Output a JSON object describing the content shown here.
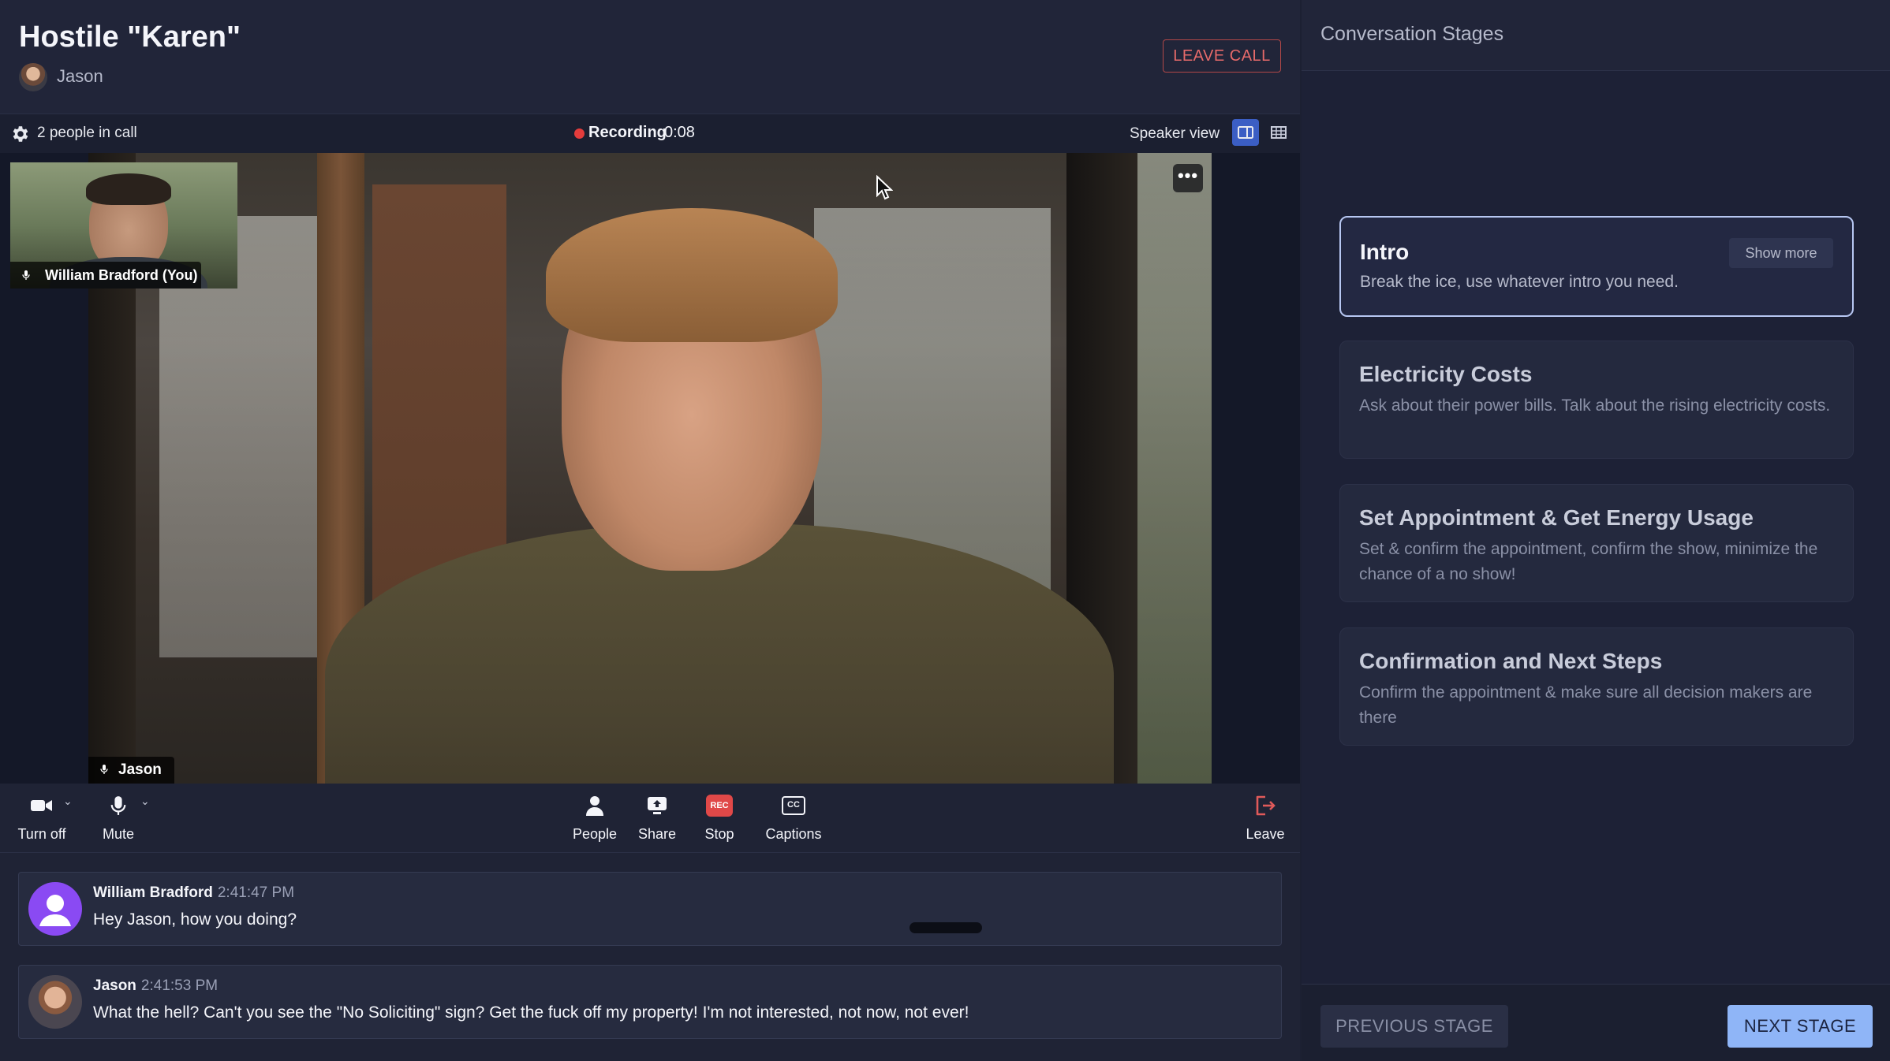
{
  "call": {
    "title": "Hostile \"Karen\"",
    "host_name": "Jason",
    "leave_call_label": "LEAVE CALL",
    "people_count": "2 people in call",
    "recording_label": "Recording",
    "recording_time": "0:08",
    "speaker_view_label": "Speaker view",
    "main_speaker": "Jason",
    "self_label": "William Bradford (You)",
    "more_label": "•••"
  },
  "toolbar": {
    "camera_label": "Turn off",
    "mute_label": "Mute",
    "people_label": "People",
    "share_label": "Share",
    "stop_label": "Stop",
    "rec_badge": "REC",
    "captions_label": "Captions",
    "captions_badge": "CC",
    "leave_label": "Leave"
  },
  "chat": [
    {
      "author": "William Bradford",
      "time": "2:41:47 PM",
      "text": "Hey Jason, how you doing?"
    },
    {
      "author": "Jason",
      "time": "2:41:53 PM",
      "text": "What the hell? Can't you see the \"No Soliciting\" sign? Get the fuck off my property! I'm not interested, not now, not ever!"
    }
  ],
  "stages_panel": {
    "title": "Conversation Stages",
    "show_more_label": "Show more",
    "stages": [
      {
        "title": "Intro",
        "description": "Break the ice, use whatever intro you need.",
        "active": true
      },
      {
        "title": "Electricity Costs",
        "description": "Ask about their power bills. Talk about the rising electricity costs.",
        "active": false
      },
      {
        "title": "Set Appointment & Get Energy Usage",
        "description": "Set & confirm the appointment, confirm the show, minimize the chance of a no show!",
        "active": false
      },
      {
        "title": "Confirmation and Next Steps",
        "description": "Confirm the appointment & make sure all decision makers are there",
        "active": false
      }
    ],
    "previous_label": "PREVIOUS STAGE",
    "next_label": "NEXT STAGE"
  },
  "colors": {
    "accent": "#3b5ec4",
    "next_button": "#8fb5f7",
    "recording": "#e43c3c",
    "leave": "#e66a6a"
  }
}
